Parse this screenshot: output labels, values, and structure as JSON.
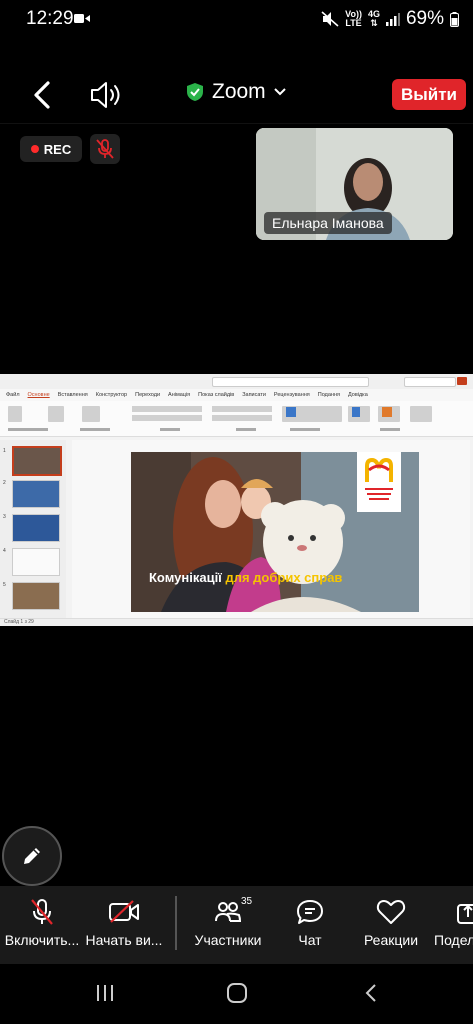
{
  "status_bar": {
    "time": "12:29",
    "network_line1": "Vo))",
    "network_line2": "LTE",
    "network_type": "4G",
    "battery": "69%"
  },
  "top_bar": {
    "app_title": "Zoom",
    "leave_label": "Выйти"
  },
  "recording": {
    "label": "REC"
  },
  "video": {
    "participant_name": "Ельнара Іманова"
  },
  "shared_screen": {
    "ppt_tabs": [
      "Файл",
      "Основне",
      "Вставлення",
      "Конструктор",
      "Переходи",
      "Анімація",
      "Показ слайдів",
      "Записати",
      "Рецензування",
      "Подання",
      "Довідка"
    ],
    "slide_text_main": "Комунікації",
    "slide_text_accent": "для добрих справ",
    "slide_count": "Слайд 1 з 29"
  },
  "toolbar": {
    "mic_label": "Включить...",
    "video_label": "Начать ви...",
    "participants_label": "Участники",
    "participants_count": "35",
    "chat_label": "Чат",
    "reactions_label": "Реакции",
    "share_label": "Подел"
  },
  "colors": {
    "leave_button": "#e0252a",
    "rec_dot": "#ff2b2b",
    "accent_yellow": "#f5c400",
    "shield_green": "#2bb34a"
  }
}
